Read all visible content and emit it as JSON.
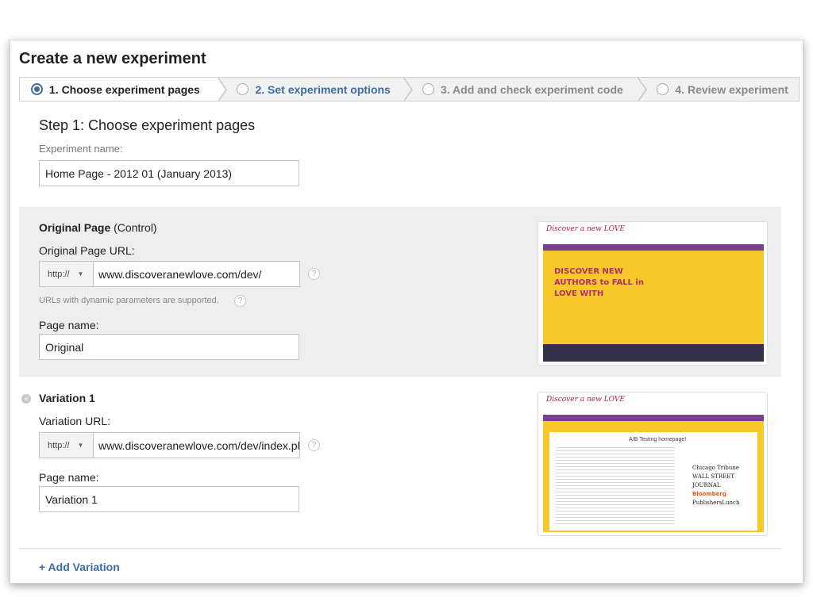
{
  "page": {
    "title": "Create a new experiment"
  },
  "steps": [
    {
      "label": "1. Choose experiment pages",
      "state": "active"
    },
    {
      "label": "2. Set experiment options",
      "state": "next"
    },
    {
      "label": "3. Add and check experiment code",
      "state": "pending"
    },
    {
      "label": "4. Review experiment",
      "state": "pending"
    }
  ],
  "step1": {
    "heading": "Step 1: Choose experiment pages",
    "experiment_name_label": "Experiment name:",
    "experiment_name_value": "Home Page - 2012 01 (January 2013)"
  },
  "original": {
    "title_bold": "Original Page",
    "title_rest": " (Control)",
    "url_label": "Original Page URL:",
    "protocol": "http://",
    "url_value": "www.discoveranewlove.com/dev/",
    "dynamic_note": "URLs with dynamic parameters are supported.",
    "page_name_label": "Page name:",
    "page_name_value": "Original",
    "thumb_logo": "Discover a new LOVE",
    "thumb_hero": "DISCOVER NEW AUTHORS to FALL in LOVE WITH"
  },
  "variation": {
    "title": "Variation 1",
    "url_label": "Variation URL:",
    "protocol": "http://",
    "url_value": "www.discoveranewlove.com/dev/index.ph",
    "page_name_label": "Page name:",
    "page_name_value": "Variation 1",
    "thumb_logo": "Discover a new LOVE",
    "thumb_title": "A/B Testing homepage!",
    "thumb_press": [
      "Chicago Tribune",
      "WALL STREET JOURNAL",
      "Bloomberg",
      "PublishersLunch"
    ]
  },
  "actions": {
    "add_variation": "+ Add Variation"
  },
  "icons": {
    "help": "?",
    "remove": "×",
    "caret": "▼"
  },
  "colors": {
    "accent": "#3b6ca8",
    "section_bg": "#eeeeee",
    "thumb_yellow": "#f7c82a",
    "thumb_purple": "#7a3f8e"
  }
}
